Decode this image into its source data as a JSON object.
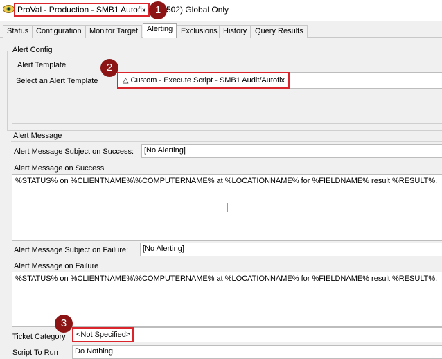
{
  "window": {
    "title_highlighted": "ProVal - Production - SMB1 Autofix",
    "title_rest": "502) Global Only"
  },
  "tabs": [
    {
      "label": "Status"
    },
    {
      "label": "Configuration"
    },
    {
      "label": "Monitor Target"
    },
    {
      "label": "Alerting"
    },
    {
      "label": "Exclusions"
    },
    {
      "label": "History"
    },
    {
      "label": "Query Results"
    }
  ],
  "alert_config": {
    "group_title": "Alert Config",
    "template_group_title": "Alert Template",
    "select_label": "Select an Alert Template",
    "template_icon": "△",
    "template_value": "Custom - Execute Script - SMB1 Audit/Autofix"
  },
  "alert_message": {
    "group_title": "Alert Message",
    "success_subject_label": "Alert Message Subject on Success:",
    "success_subject_value": "[No Alerting]",
    "success_body_label": "Alert Message on Success",
    "success_body_value": "%STATUS% on %CLIENTNAME%\\%COMPUTERNAME% at %LOCATIONNAME% for %FIELDNAME% result %RESULT%.",
    "failure_subject_label": "Alert Message Subject on Failure:",
    "failure_subject_value": "[No Alerting]",
    "failure_body_label": "Alert Message on Failure",
    "failure_body_value": "%STATUS% on %CLIENTNAME%\\%COMPUTERNAME% at %LOCATIONNAME% for %FIELDNAME% result %RESULT%."
  },
  "ticket": {
    "category_label": "Ticket Category",
    "category_value": "<Not Specified>",
    "script_label": "Script To Run",
    "script_value": "Do Nothing"
  },
  "callouts": [
    "1",
    "2",
    "3"
  ],
  "colors": {
    "highlight": "#d9252b",
    "badge": "#8c1414"
  }
}
